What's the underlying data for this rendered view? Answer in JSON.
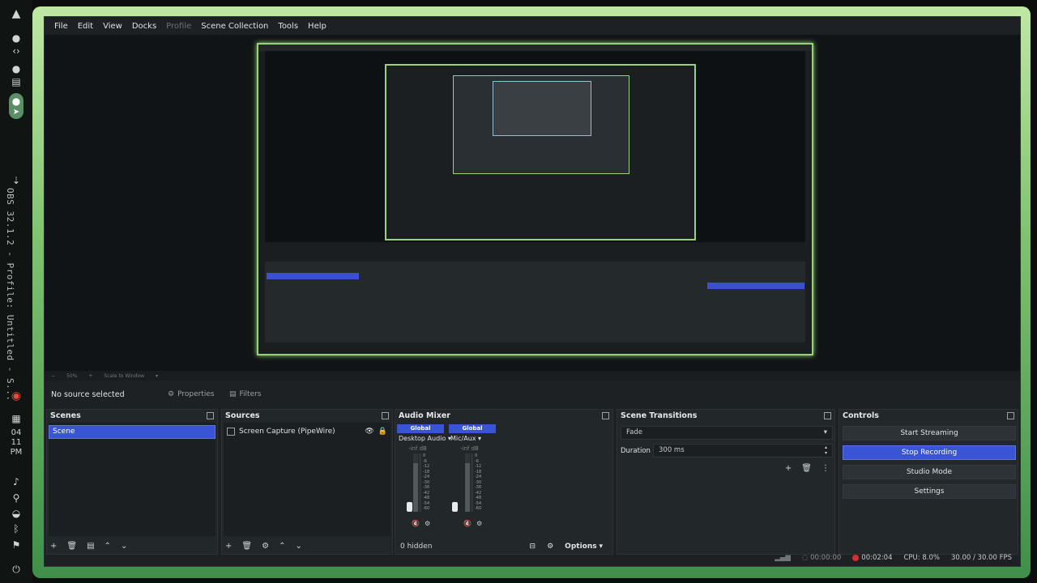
{
  "desktop": {
    "vertical_label": "OBS 32.1.2 - Profile: Untitled - S...",
    "clock": [
      "04",
      "11",
      "PM"
    ],
    "icons": [
      "app-launcher-icon",
      "circle-icon",
      "code-icon",
      "circle-icon",
      "calendar-icon",
      "active-app-icon",
      "cursor-icon",
      "download-icon",
      "chrome-icon",
      "calendar-icon",
      "volume-icon",
      "microphone-icon",
      "wifi-icon",
      "bluetooth-icon",
      "pin-icon",
      "power-icon"
    ]
  },
  "window": {
    "menus": [
      {
        "label": "File",
        "disabled": false
      },
      {
        "label": "Edit",
        "disabled": false
      },
      {
        "label": "View",
        "disabled": false
      },
      {
        "label": "Docks",
        "disabled": false
      },
      {
        "label": "Profile",
        "disabled": true
      },
      {
        "label": "Scene Collection",
        "disabled": false
      },
      {
        "label": "Tools",
        "disabled": false
      },
      {
        "label": "Help",
        "disabled": false
      }
    ],
    "scale_bar": {
      "zoom": "50%",
      "mode": "Scale to Window"
    },
    "context": {
      "no_source": "No source selected",
      "properties": "Properties",
      "filters": "Filters"
    },
    "scenes": {
      "title": "Scenes",
      "items": [
        "Scene"
      ]
    },
    "sources": {
      "title": "Sources",
      "items": [
        "Screen Capture (PipeWire)"
      ]
    },
    "audio_mixer": {
      "title": "Audio Mixer",
      "channels": [
        {
          "badge": "Global",
          "name": "Desktop Audio",
          "db": "-inf dB"
        },
        {
          "badge": "Global",
          "name": "Mic/Aux",
          "db": "-inf dB"
        }
      ],
      "ticks": [
        "0",
        "-6",
        "-12",
        "-18",
        "-24",
        "-30",
        "-36",
        "-42",
        "-48",
        "-54",
        "-60"
      ],
      "hidden": "0 hidden",
      "options": "Options"
    },
    "scene_transitions": {
      "title": "Scene Transitions",
      "transition": "Fade",
      "duration_label": "Duration",
      "duration_value": "300 ms"
    },
    "controls": {
      "title": "Controls",
      "buttons": [
        {
          "label": "Start Streaming",
          "active": false
        },
        {
          "label": "Stop Recording",
          "active": true
        },
        {
          "label": "Studio Mode",
          "active": false
        },
        {
          "label": "Settings",
          "active": false
        }
      ]
    },
    "status": {
      "stream_time": "00:00:00",
      "rec_time": "00:02:04",
      "cpu": "CPU: 8.0%",
      "fps": "30.00 / 30.00 FPS"
    }
  },
  "colors": {
    "accent": "#3a54d6",
    "border_green": "#9ad27c",
    "record_red": "#d62f2f"
  }
}
